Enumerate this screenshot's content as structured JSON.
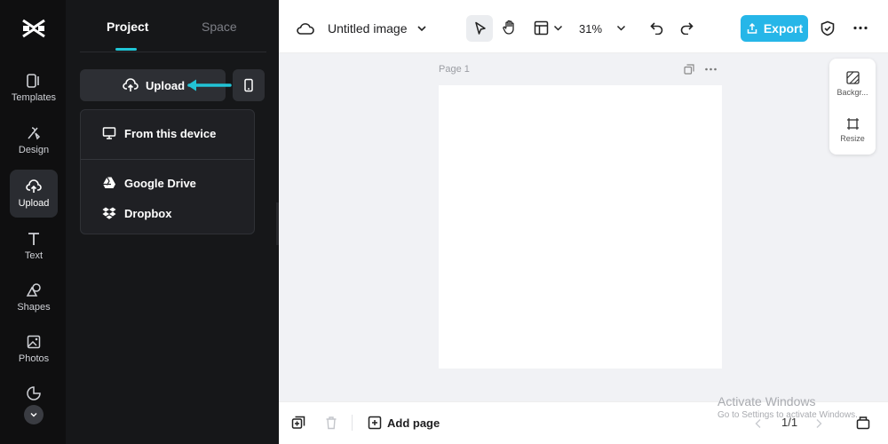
{
  "rail": {
    "items": [
      {
        "label": "Templates",
        "icon": "templates-icon"
      },
      {
        "label": "Design",
        "icon": "design-icon"
      },
      {
        "label": "Upload",
        "icon": "upload-cloud-icon",
        "active": true
      },
      {
        "label": "Text",
        "icon": "text-icon"
      },
      {
        "label": "Shapes",
        "icon": "shapes-icon"
      },
      {
        "label": "Photos",
        "icon": "photos-icon"
      }
    ]
  },
  "panel": {
    "tabs": [
      {
        "label": "Project",
        "active": true
      },
      {
        "label": "Space"
      }
    ],
    "upload_label": "Upload",
    "menu": [
      {
        "label": "From this device",
        "icon": "monitor-icon"
      },
      {
        "label": "Google Drive",
        "icon": "google-drive-icon"
      },
      {
        "label": "Dropbox",
        "icon": "dropbox-icon"
      }
    ]
  },
  "toolbar": {
    "doc_title": "Untitled image",
    "zoom": "31%",
    "export_label": "Export"
  },
  "canvas": {
    "page_label": "Page 1",
    "side_tools": [
      {
        "label": "Backgr..."
      },
      {
        "label": "Resize"
      }
    ]
  },
  "bottom": {
    "add_page_label": "Add page",
    "pager": "1/1"
  },
  "watermark": {
    "title": "Activate Windows",
    "subtitle": "Go to Settings to activate Windows."
  },
  "colors": {
    "accent": "#20c6d6",
    "export": "#26b6e8",
    "rail_bg": "#0f0f10",
    "panel_bg": "#161719"
  }
}
